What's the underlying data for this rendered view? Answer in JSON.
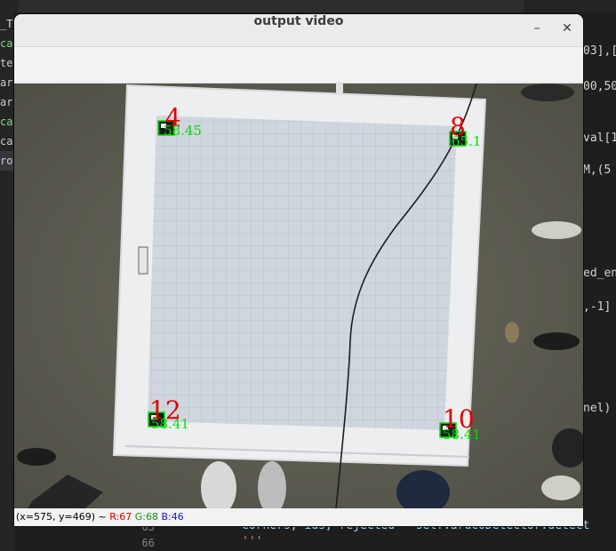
{
  "ide": {
    "sidebar_items": [
      "_TA",
      "cal",
      "tes",
      "are",
      "aru",
      "cal",
      "can",
      "ros"
    ],
    "code_right": [
      "03],[",
      "00,50",
      "val[1",
      "M,(5",
      "ed_en",
      ",-1]",
      "nel)"
    ],
    "line_numbers": [
      "65",
      "66"
    ],
    "code_bottom_1": "corners, ids, rejected = self.arucoDetector.detect",
    "code_bottom_2": "'''"
  },
  "window": {
    "title": "output video",
    "minimize_glyph": "–",
    "close_glyph": "✕"
  },
  "markers": [
    {
      "id": "4",
      "dist": "58.45"
    },
    {
      "id": "8",
      "dist": "65.1"
    },
    {
      "id": "12",
      "dist": "58.41"
    },
    {
      "id": "10",
      "dist": "58.41"
    }
  ],
  "status": {
    "coords": "(x=575, y=469) ~",
    "r": "R:67",
    "g": "G:68",
    "b": "B:46"
  },
  "colors": {
    "marker_id": "#e00000",
    "marker_distance": "#00e000",
    "status_r": "#d40000",
    "status_g": "#109010",
    "status_b": "#1a1ad0"
  }
}
